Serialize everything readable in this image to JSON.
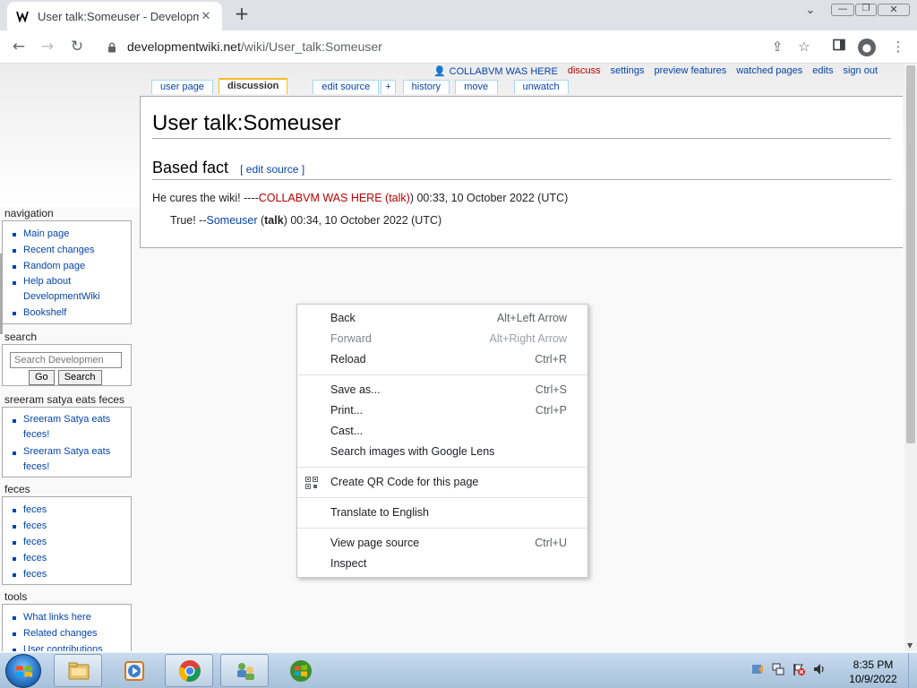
{
  "browser": {
    "tab_title": "User talk:Someuser - Developme",
    "favicon_icon": "wiki-icon",
    "url_host": "developmentwiki.net",
    "url_path": "/wiki/User_talk:Someuser"
  },
  "wiki": {
    "personal": {
      "user": "COLLABVM WAS HERE",
      "discuss": "discuss",
      "settings": "settings",
      "preview": "preview features",
      "watched": "watched pages",
      "edits": "edits",
      "signout": "sign out"
    },
    "tabs": {
      "user_page": "user page",
      "discussion": "discussion",
      "edit_source": "edit source",
      "plus": "+",
      "history": "history",
      "move": "move",
      "unwatch": "unwatch"
    },
    "heading": "User talk:Someuser",
    "section": {
      "title": "Based fact",
      "edit_open": "[",
      "edit_link": "edit source",
      "edit_close": "]"
    },
    "post1": {
      "text": "He cures the wiki! ----",
      "user": "COLLABVM WAS HERE",
      "open": " (",
      "talk": "talk",
      "close": ") 00:33, 10 October 2022 (UTC)"
    },
    "post2": {
      "text": "True! --",
      "user": "Someuser",
      "open": " (",
      "talk": "talk",
      "close": ") 00:34, 10 October 2022 (UTC)"
    },
    "sidebar": {
      "navigation": {
        "title": "navigation",
        "items": [
          "Main page",
          "Recent changes",
          "Random page",
          "Help about DevelopmentWiki",
          "Bookshelf"
        ]
      },
      "search": {
        "title": "search",
        "placeholder": "Search Developmen",
        "go": "Go",
        "search": "Search"
      },
      "custom1": {
        "title": "sreeram satya eats feces",
        "items": [
          "Sreeram Satya eats feces!",
          "Sreeram Satya eats feces!"
        ]
      },
      "feces": {
        "title": "feces",
        "items": [
          "feces",
          "feces",
          "feces",
          "feces",
          "feces"
        ]
      },
      "tools": {
        "title": "tools",
        "items": [
          "What links here",
          "Related changes",
          "User contributions"
        ]
      }
    }
  },
  "context_menu": {
    "items": [
      {
        "label": "Back",
        "shortcut": "Alt+Left Arrow"
      },
      {
        "label": "Forward",
        "shortcut": "Alt+Right Arrow"
      },
      {
        "label": "Reload",
        "shortcut": "Ctrl+R"
      },
      {
        "label": "Save as...",
        "shortcut": "Ctrl+S"
      },
      {
        "label": "Print...",
        "shortcut": "Ctrl+P"
      },
      {
        "label": "Cast...",
        "shortcut": ""
      },
      {
        "label": "Search images with Google Lens",
        "shortcut": ""
      },
      {
        "label": "Create QR Code for this page",
        "shortcut": ""
      },
      {
        "label": "Translate to English",
        "shortcut": ""
      },
      {
        "label": "View page source",
        "shortcut": "Ctrl+U"
      },
      {
        "label": "Inspect",
        "shortcut": ""
      }
    ]
  },
  "taskbar": {
    "time": "8:35 PM",
    "date": "10/9/2022"
  },
  "colors": {
    "link": "#0645ad",
    "redlink": "#ba0000",
    "tab_selected_border": "#fabd23"
  }
}
